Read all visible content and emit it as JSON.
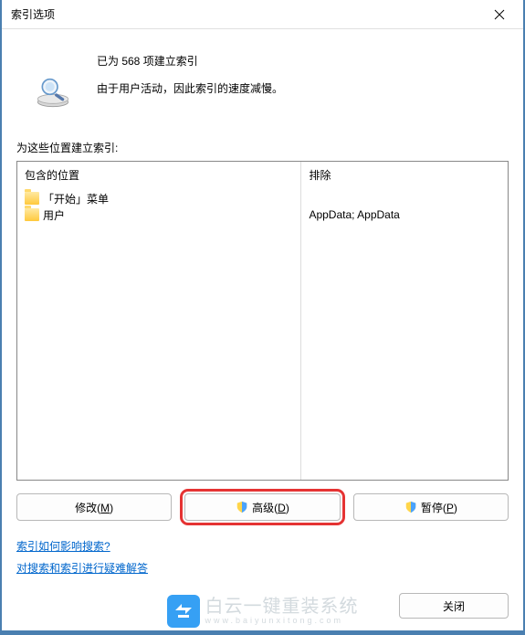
{
  "window": {
    "title": "索引选项"
  },
  "status": {
    "indexed_line": "已为 568 项建立索引",
    "message": "由于用户活动，因此索引的速度减慢。"
  },
  "locations": {
    "section_label": "为这些位置建立索引:",
    "included_header": "包含的位置",
    "excluded_header": "排除",
    "included": [
      {
        "name": "「开始」菜单"
      },
      {
        "name": "用户"
      }
    ],
    "excluded": [
      "",
      "AppData; AppData"
    ]
  },
  "buttons": {
    "modify": "修改(M)",
    "modify_label": "修改(",
    "modify_accel": "M",
    "modify_suffix": ")",
    "advanced_label": "高级(",
    "advanced_accel": "D",
    "advanced_suffix": ")",
    "pause_label": "暂停(",
    "pause_accel": "P",
    "pause_suffix": ")",
    "close": "关闭"
  },
  "links": {
    "how_affects_search": "索引如何影响搜索?",
    "troubleshoot": "对搜索和索引进行疑难解答"
  },
  "watermark": {
    "line1": "白云一键重装系统",
    "line2": "www.baiyunxitong.com"
  }
}
